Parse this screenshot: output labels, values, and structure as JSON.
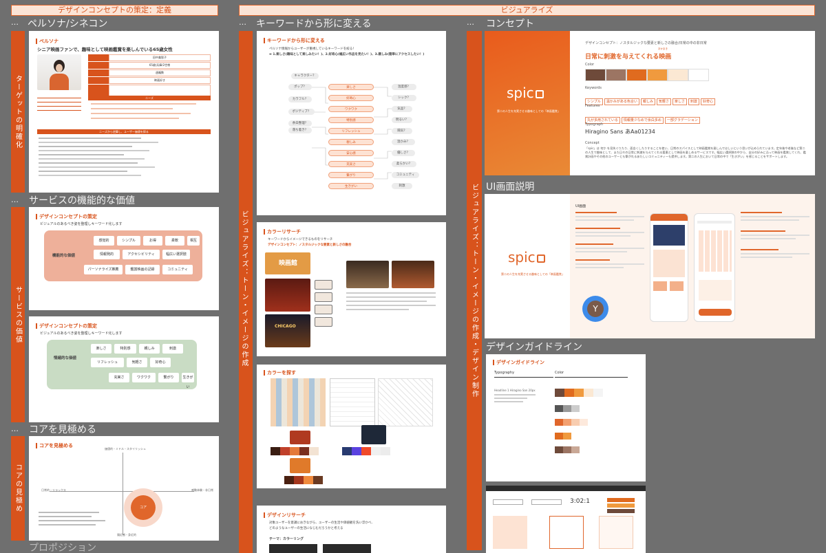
{
  "headers": {
    "left": "デザインコンセプトの策定：定義",
    "right": "ビジュアライズ"
  },
  "dots": "…",
  "sections": {
    "persona": "ペルソナ/シネコン",
    "functional": "サービスの機能的な価値",
    "core": "コアを見極める",
    "proposition": "プロポジション",
    "keyword": "キーワードから形に変える",
    "concept": "コンセプト",
    "ui": "UI画面説明",
    "guideline": "デザインガイドライン"
  },
  "vbars": {
    "target": "ターゲットの明確化",
    "value": "サービスの価値",
    "core": "コアの見極め",
    "visual_mid": "ビジュアライズ：トーン・イメージの作成",
    "visual_right": "ビジュアライズ：トーン・イメージの作成・デザイン制作"
  },
  "persona_card": {
    "title": "ペルソナ",
    "subtitle": "シニア映画ファンで、趣味として映画鑑賞を楽しんでいる65歳女性",
    "rows": [
      "田中美智子",
      "65歳/兵庫/2世帯",
      "週複数",
      "映画好き",
      "未定"
    ],
    "needs_title": "ニーズ",
    "bottom_title": "ニーズから逆算し、ユーザー価値を探る"
  },
  "functional_card": {
    "title": "デザインコンセプトの策定",
    "desc": "ビジュアルのあるべき姿を整理しキーワード化します",
    "label": "機能的な価値",
    "keywords": [
      "感覚的",
      "シンプル",
      "お得",
      "柔軟",
      "相互",
      "情報発的",
      "アクセシビリティ",
      "幅広い選択肢",
      "パーソナライズ推薦",
      "鑑賞映画の記録",
      "コミュニティ"
    ]
  },
  "emotional_card": {
    "title": "デザインコンセプトの策定",
    "desc": "ビジュアルのあるべき姿を整理しキーワード化します",
    "label": "情緒的な価値",
    "keywords": [
      "楽しさ",
      "特別感",
      "親しみ",
      "刺激",
      "リフレッシュ",
      "気軽さ",
      "好奇心",
      "充実さ",
      "ワクワク",
      "繋がり",
      "生きがい"
    ]
  },
  "core_card": {
    "title": "コアを見極める",
    "top": "価値的・ミドル・スタイリッシュ",
    "left": "日常的・リラックス",
    "right": "感動体験・非日常",
    "bottom": "親近感・身近的",
    "center": "コア"
  },
  "keyword_card": {
    "title": "キーワードから形に変える",
    "desc1": "ペルソナ情報からユーザーが重視しているキーワードを絞る！",
    "desc2": "➡ 1.楽しさ(趣味として楽しみたい！)、2.好奇心(幅広い作品を見たい！)、3.親しみ(簡単にアクセスしたい！)",
    "left": [
      "キャラクター？",
      "ポップ？",
      "カラフル？",
      "ポジティブ？",
      "余白整理？",
      "落ち着き？"
    ],
    "center": [
      "楽しさ",
      "好奇心",
      "ワクワク",
      "特別感",
      "リフレッシュ",
      "親しみ",
      "安心感",
      "充実さ",
      "繋がり",
      "生きがい"
    ],
    "right": [
      "温度感？",
      "シック？",
      "気品？",
      "明るい？",
      "陽気？",
      "温かみ？",
      "優しさ？",
      "柔らかい？",
      "コミュニティ",
      "刺激"
    ]
  },
  "color_research": {
    "title": "カラーリサーチ",
    "desc1": "キーワードからイメージできるものをリサーチ",
    "desc2": "デザインコンセプト：ノスタルジックな要素と新しさの融合",
    "theater": "映画館",
    "chicago": "CHICAGO"
  },
  "color_search": {
    "title": "カラーを探す"
  },
  "design_research": {
    "title": "デザインリサーチ",
    "desc1": "対象ユーザーを意識におきながら、ユーザーの生活や価値観を洗い浮かべ、",
    "desc2": "どのようなユーザーの生活になじむだろうかと考える",
    "theme": "テーマ：カラーリング"
  },
  "concept_card": {
    "logo": "spic",
    "logo_caption": "第二の人生を充実させる趣味としての「映画鑑賞」",
    "head": "デザインコンセプト：ノスタルジックな要素と新しさの融合/日常の中の非日常",
    "main": "日常に刺激を与えてくれる映画",
    "ruby": "おかまき",
    "color_label": "Color",
    "colors": [
      "#6e4a3a",
      "#9c7563",
      "#e06b1f",
      "#f09a3e",
      "#fbe8d3",
      "#ffffff"
    ],
    "keywords_label": "Keywords",
    "keywords": [
      "シンプル",
      "温かみがある色合い",
      "親しみ",
      "気軽さ",
      "楽しさ",
      "刺激",
      "好奇心"
    ],
    "features_label": "Features",
    "features": [
      "丸が多用されている",
      "情報量少なめで余白多め",
      "一部グラデーション"
    ],
    "typo_label": "Typograph",
    "typo": "Hiragino Sans あAa01234",
    "concept_label": "Concept",
    "concept_text": "「spic」は 何か を見失ぐりたり、面白くしたりすることを使い、日常のスパイスとして映画鑑賞を楽しんではしいという思いが込められています。定年後や老後など第二の人生で趣味として、また日々の日常に刺激を与えてくれる要素として映画を楽しめるサービスです。幅広い選択肢の中から、自分の好みに沿って映画を鑑賞してくれ、鑑賞計画やその他のユーザーとも繋がれるあたしいコミュニティーも提供します。第二の人生において日常の中で「生きがい」を感じることをサポートします。"
  },
  "ui_card": {
    "logo": "spic",
    "logo_caption": "第二の人生を充実させる趣味としての「映画鑑賞」",
    "screen_title": "UI画面",
    "avatar": "Y"
  },
  "guideline_card": {
    "title": "デザインガイドライン",
    "typography": "Typography",
    "color": "Color",
    "heading": "Headline 1 Hiragino San 20px",
    "time": "3:02:1"
  }
}
